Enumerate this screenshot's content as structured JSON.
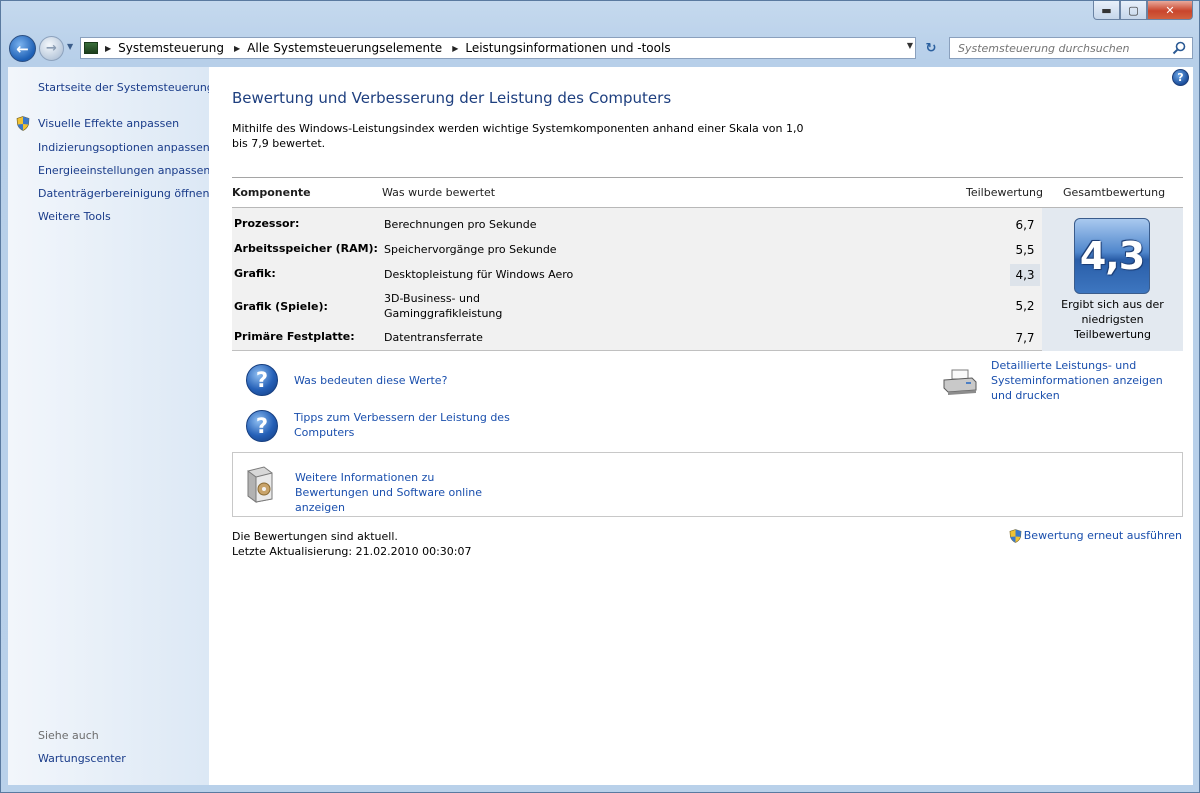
{
  "window": {
    "controls": {
      "minimize": "▬",
      "maximize": "▢",
      "close": "✕"
    }
  },
  "nav": {
    "breadcrumbs": [
      "Systemsteuerung",
      "Alle Systemsteuerungselemente",
      "Leistungsinformationen und -tools"
    ],
    "search_placeholder": "Systemsteuerung durchsuchen"
  },
  "sidebar": {
    "home": "Startseite der Systemsteuerung",
    "tasks": [
      "Visuelle Effekte anpassen",
      "Indizierungsoptionen anpassen",
      "Energieeinstellungen anpassen",
      "Datenträgerbereinigung öffnen",
      "Weitere Tools"
    ],
    "see_also_heading": "Siehe auch",
    "see_also": [
      "Wartungscenter"
    ]
  },
  "main": {
    "title": "Bewertung und Verbesserung der Leistung des Computers",
    "intro": "Mithilfe des Windows-Leistungsindex werden wichtige Systemkomponenten anhand einer Skala von 1,0 bis 7,9 bewertet.",
    "table": {
      "headers": {
        "component": "Komponente",
        "what": "Was wurde bewertet",
        "subscore": "Teilbewertung",
        "base": "Gesamtbewertung"
      },
      "rows": [
        {
          "component": "Prozessor:",
          "what": "Berechnungen pro Sekunde",
          "score": "6,7",
          "lowest": false
        },
        {
          "component": "Arbeitsspeicher (RAM):",
          "what": "Speichervorgänge pro Sekunde",
          "score": "5,5",
          "lowest": false
        },
        {
          "component": "Grafik:",
          "what": "Desktopleistung für Windows Aero",
          "score": "4,3",
          "lowest": true
        },
        {
          "component": "Grafik (Spiele):",
          "what": "3D-Business- und Gaminggrafikleistung",
          "score": "5,2",
          "lowest": false
        },
        {
          "component": "Primäre Festplatte:",
          "what": "Datentransferrate",
          "score": "7,7",
          "lowest": false
        }
      ],
      "base_score": "4,3",
      "base_caption": "Ergibt sich aus der niedrigsten Teilbewertung"
    },
    "links": {
      "what_mean": "Was bedeuten diese Werte?",
      "tips": "Tipps zum Verbessern der Leistung des Computers",
      "details": "Detaillierte Leistungs- und Systeminformationen anzeigen und drucken",
      "online": "Weitere Informationen zu Bewertungen und Software online anzeigen"
    },
    "status": {
      "current": "Die Bewertungen sind aktuell.",
      "last_update": "Letzte Aktualisierung: 21.02.2010 00:30:07"
    },
    "rerun": "Bewertung erneut ausführen"
  }
}
